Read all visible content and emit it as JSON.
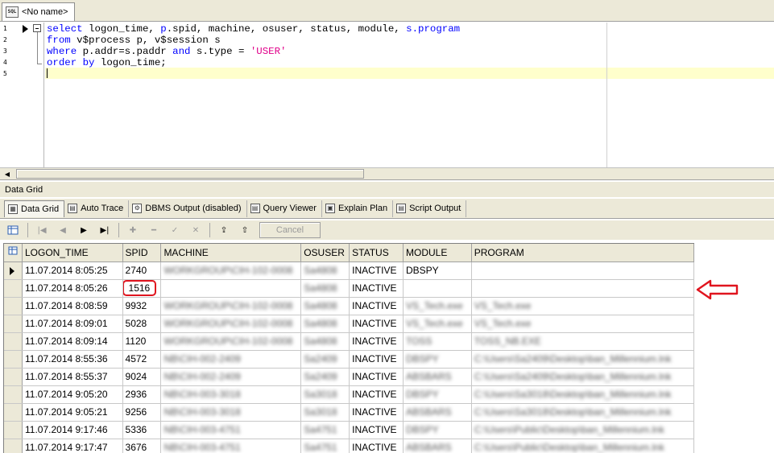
{
  "document_tab": {
    "icon": "sql-file-icon",
    "icon_text": "SQL",
    "label": "<No name>"
  },
  "editor": {
    "line_numbers": [
      "1",
      "2",
      "3",
      "4",
      "5"
    ],
    "lines": [
      [
        {
          "t": "select",
          "k": "kw"
        },
        {
          "t": " logon_time, ",
          "k": ""
        },
        {
          "t": "p",
          "k": "kw"
        },
        {
          "t": ".spid, machine, osuser, status, module, ",
          "k": ""
        },
        {
          "t": "s",
          "k": "kw"
        },
        {
          "t": ".program",
          "k": "kw"
        }
      ],
      [
        {
          "t": "from",
          "k": "kw"
        },
        {
          "t": " v$process p, v$session s",
          "k": ""
        }
      ],
      [
        {
          "t": "where",
          "k": "kw"
        },
        {
          "t": " p.addr=s.paddr ",
          "k": ""
        },
        {
          "t": "and",
          "k": "kw"
        },
        {
          "t": " s.type = ",
          "k": ""
        },
        {
          "t": "'USER'",
          "k": "str"
        }
      ],
      [
        {
          "t": "order by",
          "k": "kw"
        },
        {
          "t": " logon_time;",
          "k": ""
        }
      ],
      []
    ],
    "colors": {
      "keyword": "#0000ff",
      "string": "#e0008a",
      "current_line": "#ffffcc"
    }
  },
  "panel_title": "Data Grid",
  "result_tabs": [
    {
      "label": "Data Grid",
      "icon": "grid-icon",
      "active": true
    },
    {
      "label": "Auto Trace",
      "icon": "document-icon",
      "active": false
    },
    {
      "label": "DBMS Output (disabled)",
      "icon": "dbms-output-icon",
      "active": false
    },
    {
      "label": "Query Viewer",
      "icon": "query-viewer-icon",
      "active": false
    },
    {
      "label": "Explain Plan",
      "icon": "explain-plan-icon",
      "active": false
    },
    {
      "label": "Script Output",
      "icon": "script-output-icon",
      "active": false
    }
  ],
  "toolbar": {
    "buttons": [
      {
        "name": "first-record",
        "glyph": "|◀",
        "enabled": false
      },
      {
        "name": "prior-record",
        "glyph": "◀",
        "enabled": false
      },
      {
        "name": "next-record",
        "glyph": "▶",
        "enabled": true
      },
      {
        "name": "last-record",
        "glyph": "▶|",
        "enabled": true
      },
      {
        "name": "insert-record",
        "glyph": "✚",
        "enabled": false
      },
      {
        "name": "delete-record",
        "glyph": "━",
        "enabled": false
      },
      {
        "name": "post-edit",
        "glyph": "✓",
        "enabled": false
      },
      {
        "name": "cancel-edit",
        "glyph": "✕",
        "enabled": false
      },
      {
        "name": "export",
        "glyph": "⇪",
        "enabled": true
      },
      {
        "name": "import",
        "glyph": "⇧",
        "enabled": true
      }
    ],
    "cancel_label": "Cancel"
  },
  "grid": {
    "columns": [
      "LOGON_TIME",
      "SPID",
      "MACHINE",
      "OSUSER",
      "STATUS",
      "MODULE",
      "PROGRAM"
    ],
    "rows": [
      {
        "logon_time": "11.07.2014 8:05:25",
        "spid": "2740",
        "machine": "WORKGROUP\\CIH-102-0008",
        "osuser": "Sa4808",
        "status": "INACTIVE",
        "module": "DBSPY",
        "program": ""
      },
      {
        "logon_time": "11.07.2014 8:05:26",
        "spid": "1516",
        "machine": "",
        "osuser": "Sa4808",
        "status": "INACTIVE",
        "module": "",
        "program": ""
      },
      {
        "logon_time": "11.07.2014 8:08:59",
        "spid": "9932",
        "machine": "WORKGROUP\\CIH-102-0008",
        "osuser": "Sa4808",
        "status": "INACTIVE",
        "module": "VS_Tech.exe",
        "program": "VS_Tech.exe"
      },
      {
        "logon_time": "11.07.2014 8:09:01",
        "spid": "5028",
        "machine": "WORKGROUP\\CIH-102-0008",
        "osuser": "Sa4808",
        "status": "INACTIVE",
        "module": "VS_Tech.exe",
        "program": "VS_Tech.exe"
      },
      {
        "logon_time": "11.07.2014 8:09:14",
        "spid": "1120",
        "machine": "WORKGROUP\\CIH-102-0008",
        "osuser": "Sa4808",
        "status": "INACTIVE",
        "module": "TOSS",
        "program": "TOSS_NB.EXE"
      },
      {
        "logon_time": "11.07.2014 8:55:36",
        "spid": "4572",
        "machine": "NB\\CIH-002-2409",
        "osuser": "Sa2409",
        "status": "INACTIVE",
        "module": "DBSPY",
        "program": "C:\\Users\\Sa2409\\Desktop\\ban_Millennium.lnk"
      },
      {
        "logon_time": "11.07.2014 8:55:37",
        "spid": "9024",
        "machine": "NB\\CIH-002-2409",
        "osuser": "Sa2409",
        "status": "INACTIVE",
        "module": "ABSBARS",
        "program": "C:\\Users\\Sa2409\\Desktop\\ban_Millennium.lnk"
      },
      {
        "logon_time": "11.07.2014 9:05:20",
        "spid": "2936",
        "machine": "NB\\CIH-003-3018",
        "osuser": "Sa3018",
        "status": "INACTIVE",
        "module": "DBSPY",
        "program": "C:\\Users\\Sa3018\\Desktop\\ban_Millennium.lnk"
      },
      {
        "logon_time": "11.07.2014 9:05:21",
        "spid": "9256",
        "machine": "NB\\CIH-003-3018",
        "osuser": "Sa3018",
        "status": "INACTIVE",
        "module": "ABSBARS",
        "program": "C:\\Users\\Sa3018\\Desktop\\ban_Millennium.lnk"
      },
      {
        "logon_time": "11.07.2014 9:17:46",
        "spid": "5336",
        "machine": "NB\\CIH-003-4751",
        "osuser": "Sa4751",
        "status": "INACTIVE",
        "module": "DBSPY",
        "program": "C:\\Users\\Public\\Desktop\\ban_Millennium.lnk"
      },
      {
        "logon_time": "11.07.2014 9:17:47",
        "spid": "3676",
        "machine": "NB\\CIH-003-4751",
        "osuser": "Sa4751",
        "status": "INACTIVE",
        "module": "ABSBARS",
        "program": "C:\\Users\\Public\\Desktop\\ban_Millennium.lnk"
      }
    ],
    "current_row": 0,
    "highlighted_cell": {
      "row": 1,
      "column": "spid"
    },
    "highlight_color": "#e0141e"
  },
  "annotation": {
    "icon": "left-arrow-icon",
    "color": "#e0141e"
  }
}
